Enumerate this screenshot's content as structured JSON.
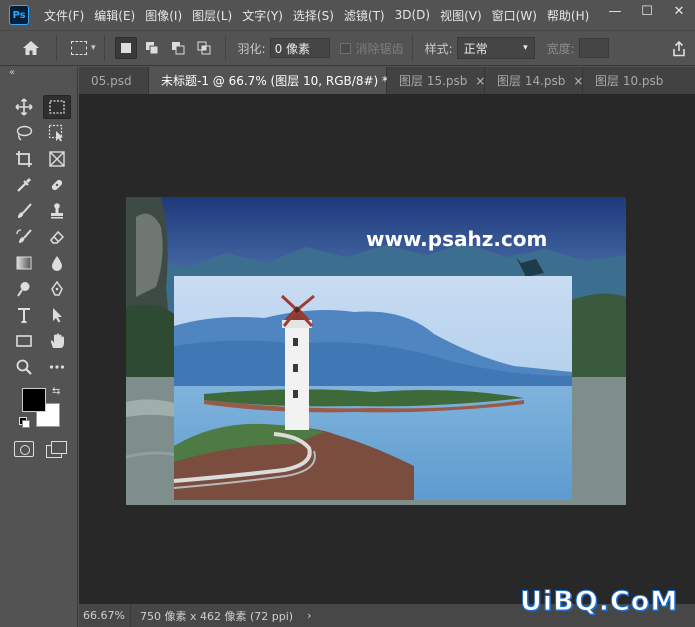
{
  "app": {
    "logo": "Ps"
  },
  "menu": [
    "文件(F)",
    "编辑(E)",
    "图像(I)",
    "图层(L)",
    "文字(Y)",
    "选择(S)",
    "滤镜(T)",
    "3D(D)",
    "视图(V)",
    "窗口(W)",
    "帮助(H)"
  ],
  "window_controls": {
    "minimize": "—",
    "maximize": "☐",
    "close": "✕"
  },
  "options": {
    "feather_label": "羽化:",
    "feather_value": "0 像素",
    "antialias_label": "消除锯齿",
    "style_label": "样式:",
    "style_value": "正常",
    "width_label": "宽度:"
  },
  "tabs": [
    {
      "label": "05.psd",
      "close": "",
      "active": false
    },
    {
      "label": "未标题-1 @ 66.7% (图层 10, RGB/8#) *",
      "close": "×",
      "active": true
    },
    {
      "label": "图层 15.psb",
      "close": "×",
      "active": false
    },
    {
      "label": "图层 14.psb",
      "close": "×",
      "active": false
    },
    {
      "label": "图层 10.psb",
      "close": "",
      "active": false
    }
  ],
  "colors": {
    "foreground": "#000000",
    "background": "#ffffff",
    "accent": "#31a8ff"
  },
  "canvas": {
    "watermark_text": "www.psahz.com"
  },
  "status": {
    "zoom": "66.67%",
    "info": "750 像素 x 462 像素 (72 ppi)",
    "arrow": "›"
  },
  "site_watermark": "UiBQ.CoM"
}
